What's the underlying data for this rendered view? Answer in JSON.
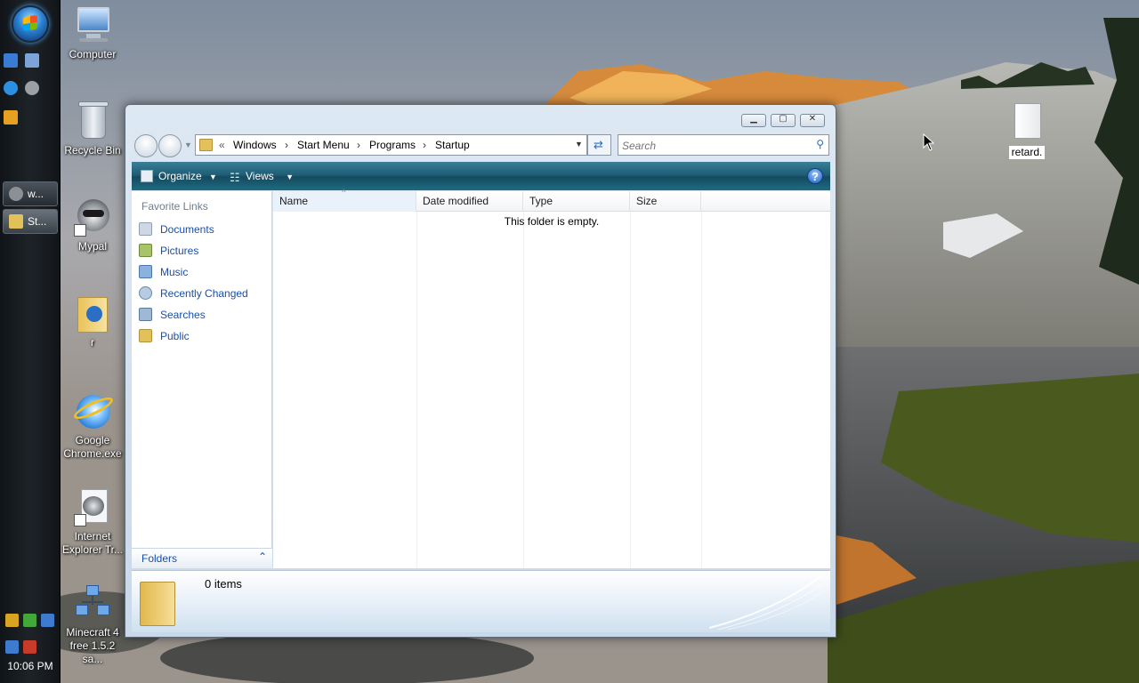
{
  "taskbar": {
    "buttons": [
      {
        "label": "w..."
      },
      {
        "label": "St..."
      }
    ],
    "clock": "10:06 PM"
  },
  "desktop_icons": [
    {
      "label": "Computer",
      "icon": "computer-icon"
    },
    {
      "label": "Recycle Bin",
      "icon": "recycle-bin-icon"
    },
    {
      "label": "Mypal",
      "icon": "mypal-icon"
    },
    {
      "label": "r",
      "icon": "folder-icon"
    },
    {
      "label": "Google Chrome.exe",
      "icon": "internet-explorer-icon"
    },
    {
      "label": "Internet Explorer Tr...",
      "icon": "mypal-shortcut-icon"
    },
    {
      "label": "Minecraft 4 free 1.5.2 sa...",
      "icon": "network-icon"
    },
    {
      "label": "retard.",
      "icon": "text-file-icon"
    }
  ],
  "explorer": {
    "breadcrumb": {
      "overflow": "«",
      "parts": [
        "Windows",
        "Start Menu",
        "Programs",
        "Startup"
      ]
    },
    "search": {
      "placeholder": "Search"
    },
    "toolbar": {
      "organize": "Organize",
      "views": "Views",
      "help": "?"
    },
    "nav_pane": {
      "heading": "Favorite Links",
      "links": [
        {
          "label": "Documents"
        },
        {
          "label": "Pictures"
        },
        {
          "label": "Music"
        },
        {
          "label": "Recently Changed"
        },
        {
          "label": "Searches"
        },
        {
          "label": "Public"
        }
      ],
      "folders_label": "Folders"
    },
    "columns": [
      "Name",
      "Date modified",
      "Type",
      "Size"
    ],
    "empty_message": "This folder is empty.",
    "details": {
      "item_count": "0 items"
    }
  },
  "colors": {
    "link_blue": "#1a4fa8",
    "toolbar_teal": "#1d5b73"
  }
}
